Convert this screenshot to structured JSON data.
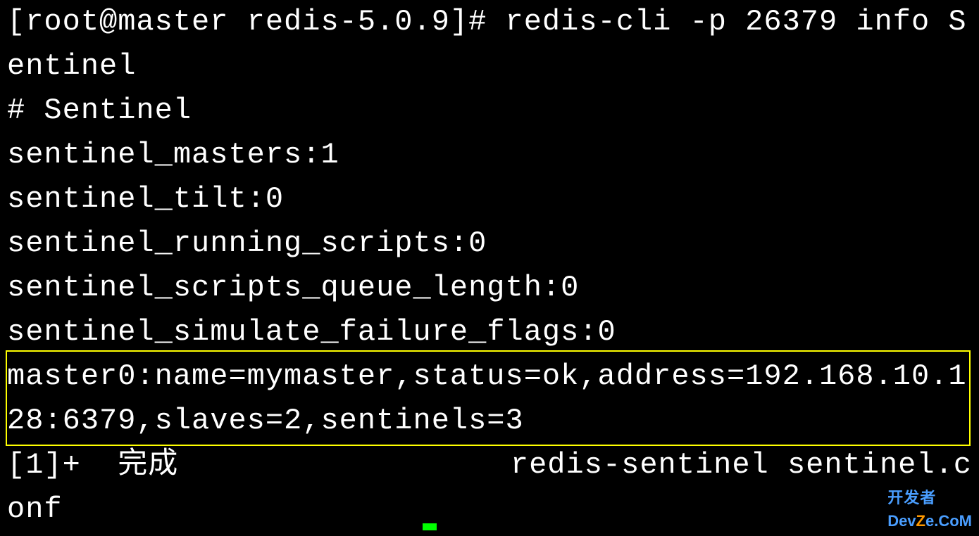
{
  "terminal": {
    "prompt_line": "[root@master redis-5.0.9]# redis-cli -p 26379 info Sentinel",
    "section_header": "# Sentinel",
    "sentinel_masters": "sentinel_masters:1",
    "sentinel_tilt": "sentinel_tilt:0",
    "sentinel_running_scripts": "sentinel_running_scripts:0",
    "sentinel_scripts_queue_length": "sentinel_scripts_queue_length:0",
    "sentinel_simulate_failure_flags": "sentinel_simulate_failure_flags:0",
    "master0_line": "master0:name=mymaster,status=ok,address=192.168.10.128:6379,slaves=2,sentinels=3",
    "job_done_line": "[1]+  完成                  redis-sentinel sentinel.conf"
  },
  "watermark": {
    "top": "开发者",
    "bottom_prefix": "Dev",
    "bottom_z": "Z",
    "bottom_suffix": "e.CoM"
  }
}
